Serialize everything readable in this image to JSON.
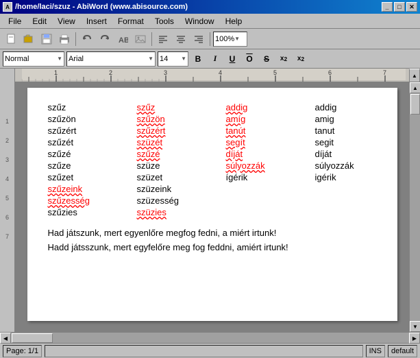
{
  "titlebar": {
    "title": "/home/laci/szuz - AbiWord (www.abisource.com)",
    "icon": "A",
    "btn_minimize": "_",
    "btn_maximize": "□",
    "btn_close": "✕"
  },
  "menubar": {
    "items": [
      "File",
      "Edit",
      "View",
      "Insert",
      "Format",
      "Tools",
      "Window",
      "Help"
    ]
  },
  "toolbar": {
    "zoom": "100%"
  },
  "formattoolbar": {
    "style": "Normal",
    "font": "Arial",
    "size": "14",
    "bold": "B",
    "italic": "I",
    "underline": "U",
    "overstrike": "O̶",
    "strikethrough": "S",
    "superscript": "x²",
    "subscript": "x₂"
  },
  "document": {
    "words": [
      {
        "col1": "szűz",
        "col2": "szűz",
        "col3": "addig",
        "col4": "addig",
        "col1_err": false,
        "col2_err": true,
        "col3_err": true,
        "col4_err": false
      },
      {
        "col1": "szűzön",
        "col2": "szűzön",
        "col3": "amíg",
        "col4": "amig",
        "col1_err": false,
        "col2_err": true,
        "col3_err": true,
        "col4_err": false
      },
      {
        "col1": "szűzért",
        "col2": "szűzért",
        "col3": "tanút",
        "col4": "tanut",
        "col1_err": false,
        "col2_err": true,
        "col3_err": true,
        "col4_err": false
      },
      {
        "col1": "szűzét",
        "col2": "szüzét",
        "col3": "segít",
        "col4": "segit",
        "col1_err": false,
        "col2_err": true,
        "col3_err": true,
        "col4_err": false
      },
      {
        "col1": "szűzé",
        "col2": "szűzé",
        "col3": "díját",
        "col4": "díját",
        "col1_err": false,
        "col2_err": true,
        "col3_err": true,
        "col4_err": false
      },
      {
        "col1": "szűze",
        "col2": "szüze",
        "col3": "súlyozzák",
        "col4": "súlyozzák",
        "col1_err": false,
        "col2_err": false,
        "col3_err": true,
        "col4_err": false
      },
      {
        "col1": "szűzet",
        "col2": "szüzet",
        "col3": "ígérik",
        "col4": "igérik",
        "col1_err": false,
        "col2_err": false,
        "col3_err": false,
        "col4_err": false
      },
      {
        "col1": "szűzeink",
        "col2": "szüzeink",
        "col3": "",
        "col4": "",
        "col1_err": true,
        "col2_err": false,
        "col3_err": false,
        "col4_err": false
      },
      {
        "col1": "szűzesség",
        "col2": "szüzesség",
        "col3": "",
        "col4": "",
        "col1_err": true,
        "col2_err": false,
        "col3_err": false,
        "col4_err": false
      },
      {
        "col1": "szűzies",
        "col2": "szüzies",
        "col3": "",
        "col4": "",
        "col1_err": false,
        "col2_err": true,
        "col3_err": false,
        "col4_err": false
      }
    ],
    "line1": "Had játszunk, mert egyenlőre megfog fedni, a miért irtunk!",
    "line2": "Hadd játsszunk, mert egyfelőre meg fog feddni, amiért irtunk!"
  },
  "statusbar": {
    "page": "Page: 1/1",
    "insert": "INS",
    "mode": "default"
  }
}
